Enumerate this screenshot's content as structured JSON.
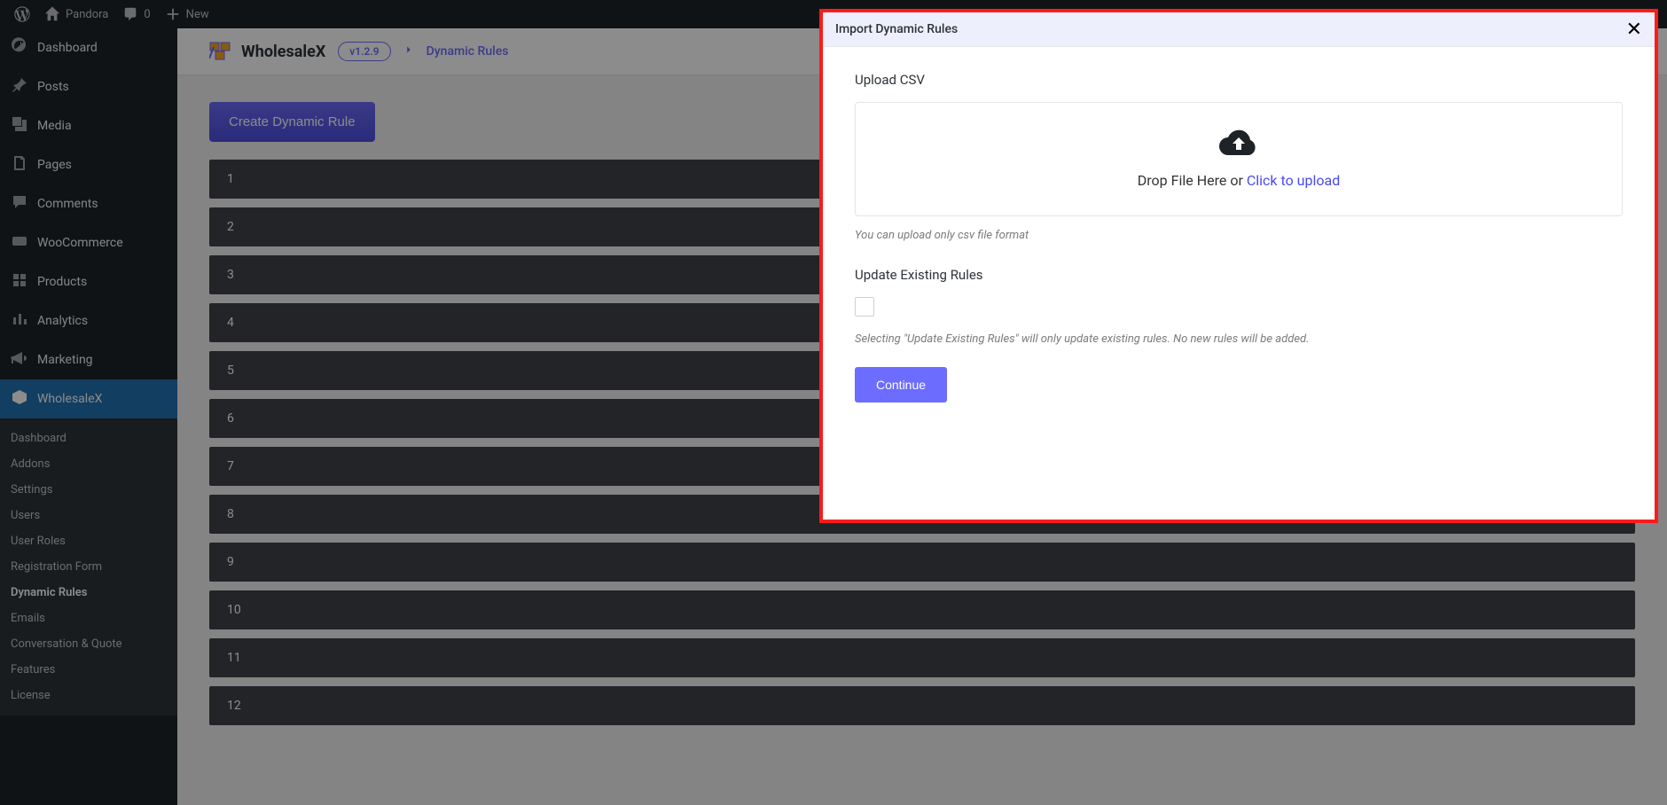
{
  "adminbar": {
    "site_name": "Pandora",
    "comments_count": "0",
    "new_label": "New"
  },
  "sidebar": {
    "items": [
      {
        "label": "Dashboard"
      },
      {
        "label": "Posts"
      },
      {
        "label": "Media"
      },
      {
        "label": "Pages"
      },
      {
        "label": "Comments"
      },
      {
        "label": "WooCommerce"
      },
      {
        "label": "Products"
      },
      {
        "label": "Analytics"
      },
      {
        "label": "Marketing"
      },
      {
        "label": "WholesaleX"
      }
    ],
    "submenu": [
      {
        "label": "Dashboard"
      },
      {
        "label": "Addons"
      },
      {
        "label": "Settings"
      },
      {
        "label": "Users"
      },
      {
        "label": "User Roles"
      },
      {
        "label": "Registration Form"
      },
      {
        "label": "Dynamic Rules"
      },
      {
        "label": "Emails"
      },
      {
        "label": "Conversation & Quote"
      },
      {
        "label": "Features"
      },
      {
        "label": "License"
      }
    ]
  },
  "header": {
    "brand": "WholesaleX",
    "version": "v1.2.9",
    "breadcrumb": "Dynamic Rules"
  },
  "main": {
    "create_btn": "Create Dynamic Rule",
    "rows": [
      "1",
      "2",
      "3",
      "4",
      "5",
      "6",
      "7",
      "8",
      "9",
      "10",
      "11",
      "12"
    ]
  },
  "modal": {
    "title": "Import Dynamic Rules",
    "upload_label": "Upload CSV",
    "drop_prefix": "Drop File Here or ",
    "drop_link": "Click to upload",
    "upload_help": "You can upload only csv file format",
    "update_label": "Update Existing Rules",
    "update_help": "Selecting \"Update Existing Rules\" will only update existing rules. No new rules will be added.",
    "continue": "Continue"
  }
}
